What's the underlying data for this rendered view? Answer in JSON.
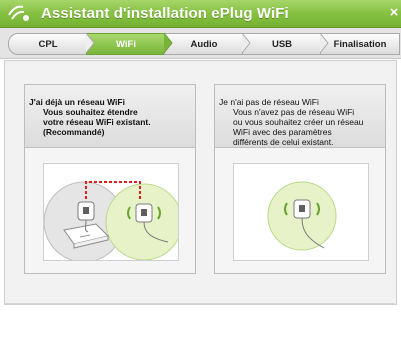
{
  "window": {
    "title": "Assistant d'installation ePlug WiFi",
    "close_glyph": "×",
    "logo_icon": "eplug-logo-icon"
  },
  "steps": [
    {
      "label": "CPL",
      "active": false
    },
    {
      "label": "WiFi",
      "active": true
    },
    {
      "label": "Audio",
      "active": false
    },
    {
      "label": "USB",
      "active": false
    },
    {
      "label": "Finalisation",
      "active": false
    }
  ],
  "options": {
    "existing": {
      "line1": "J'ai déjà un réseau WiFi",
      "line2": "Vous souhaitez étendre",
      "line3": "votre réseau WiFi existant.",
      "line4": "(Recommandé)"
    },
    "new": {
      "line1": "Je n'ai pas de réseau WiFi",
      "line2": "Vous n'avez pas de réseau WiFi",
      "line3": "ou vous souhaitez créer un réseau",
      "line4": "WiFi avec des paramètres",
      "line5": "différents de celui existant."
    }
  },
  "colors": {
    "accent_green": "#86c042",
    "wifi_circle": "#e8f2c8",
    "link_red": "#d81e1e"
  }
}
